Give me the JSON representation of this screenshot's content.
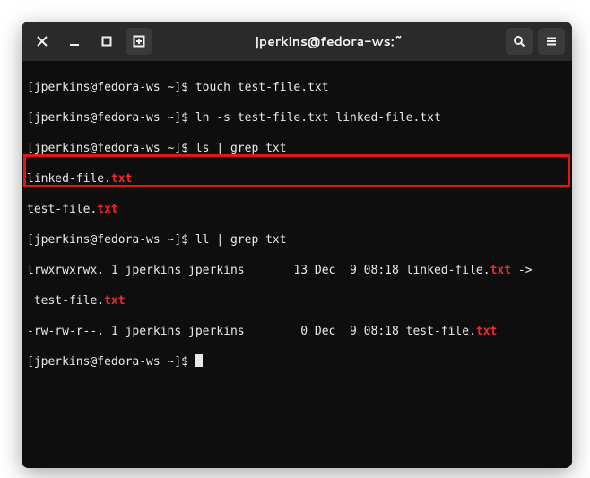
{
  "titlebar": {
    "title": "jperkins@fedora-ws:~"
  },
  "prompt": "[jperkins@fedora-ws ~]$ ",
  "commands": {
    "c1": "touch test-file.txt",
    "c2": "ln -s test-file.txt linked-file.txt",
    "c3": "ls | grep txt",
    "c4": "ll | grep txt"
  },
  "ls_output": {
    "linked_prefix": "linked-file.",
    "linked_ext": "txt",
    "test_prefix": "test-file.",
    "test_ext": "txt"
  },
  "ll_output": {
    "link_line_a": "lrwxrwxrwx. 1 jperkins jperkins       13 Dec  9 08:18 linked-file.",
    "link_line_ext1": "txt",
    "link_line_arrow": " ->",
    "link_line_b": " test-file.",
    "link_line_ext2": "txt",
    "reg_line_a": "-rw-rw-r--. 1 jperkins jperkins        0 Dec  9 08:18 test-file.",
    "reg_line_ext": "txt"
  }
}
